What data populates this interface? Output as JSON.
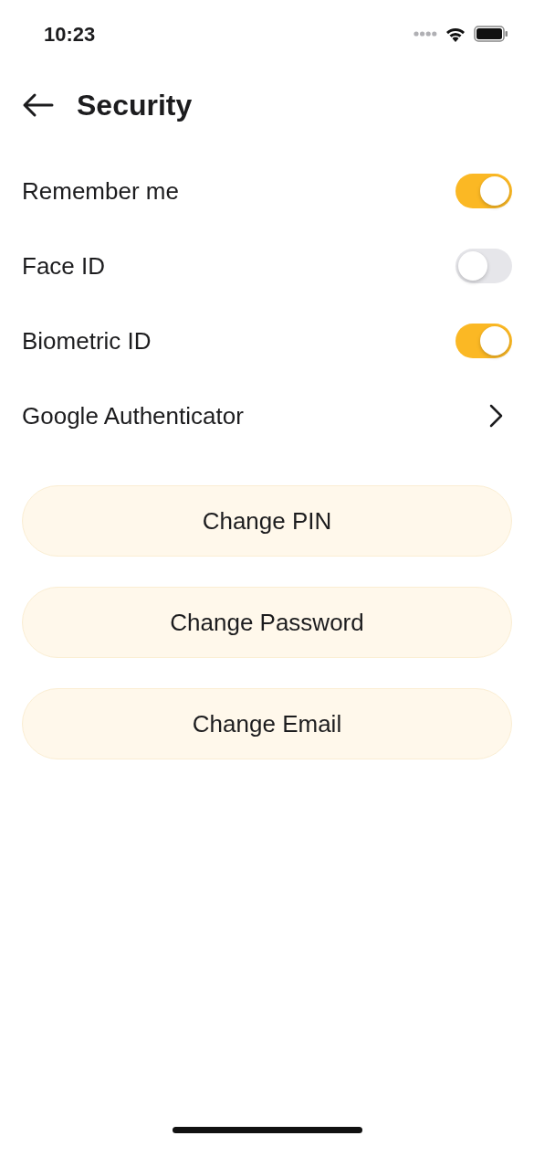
{
  "status_bar": {
    "time": "10:23"
  },
  "header": {
    "title": "Security"
  },
  "settings": [
    {
      "kind": "toggle",
      "label": "Remember me",
      "on": true
    },
    {
      "kind": "toggle",
      "label": "Face ID",
      "on": false
    },
    {
      "kind": "toggle",
      "label": "Biometric ID",
      "on": true
    },
    {
      "kind": "link",
      "label": "Google Authenticator"
    }
  ],
  "buttons": [
    "Change PIN",
    "Change Password",
    "Change Email"
  ]
}
